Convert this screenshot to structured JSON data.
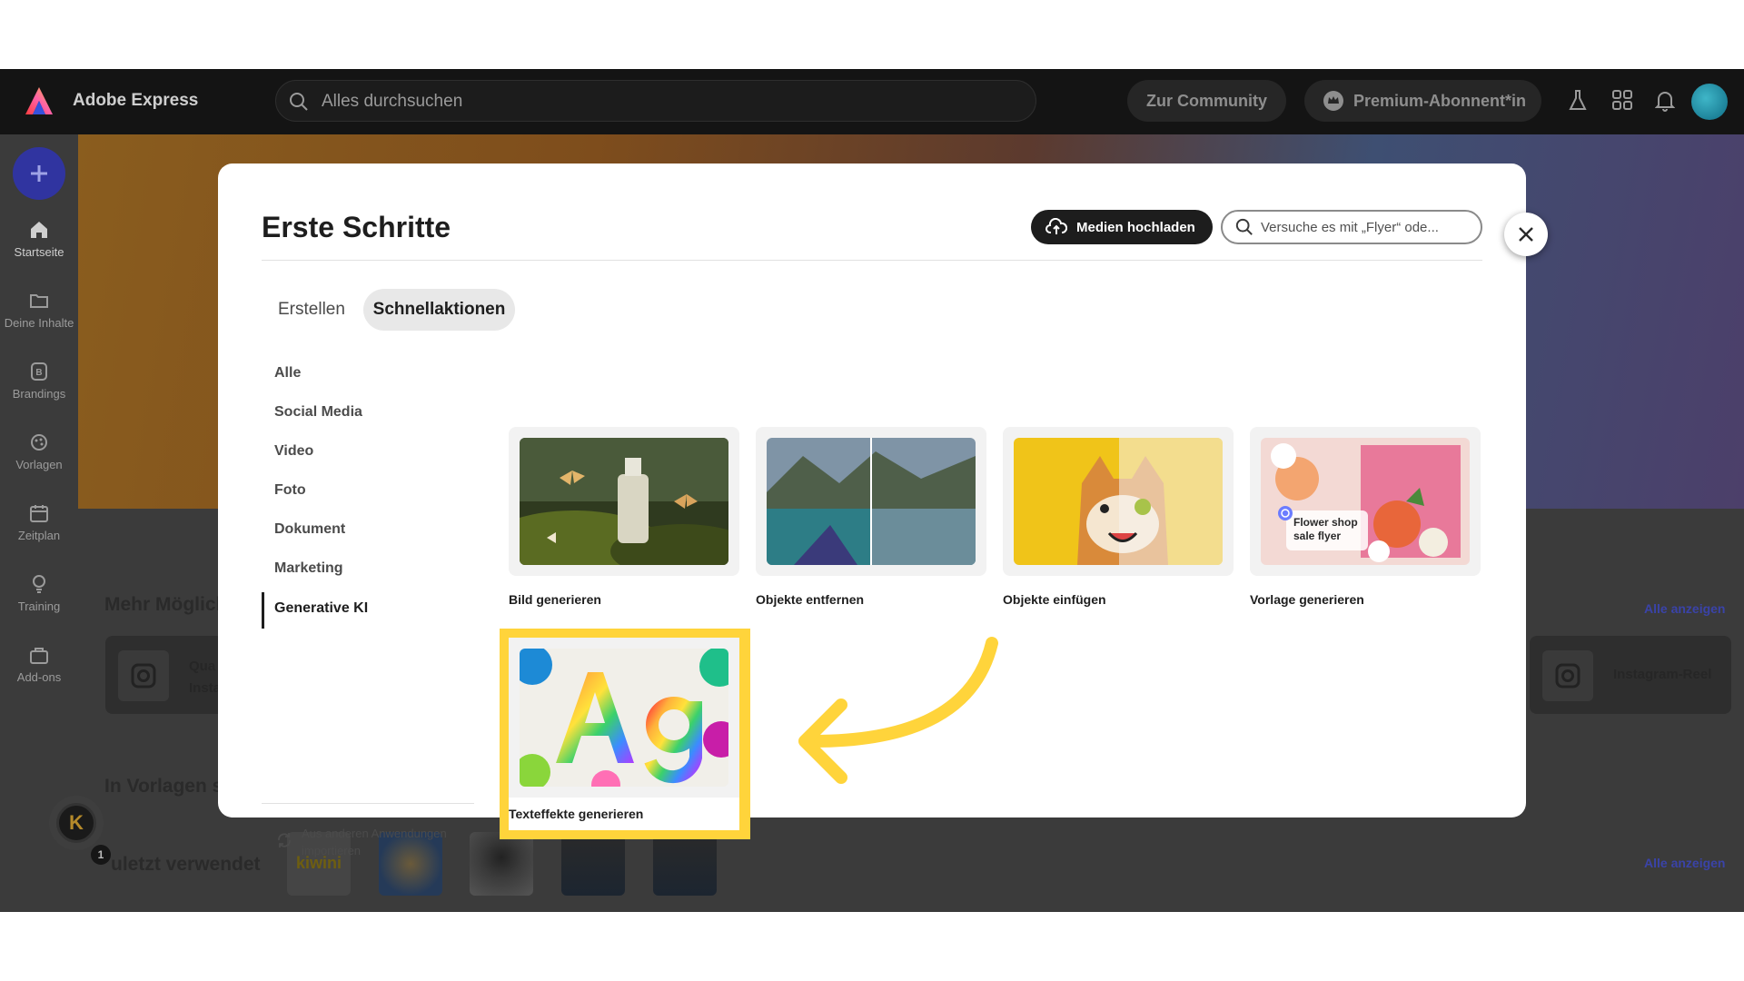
{
  "topbar": {
    "brand": "Adobe Express",
    "search_placeholder": "Alles durchsuchen",
    "community_label": "Zur Community",
    "premium_label": "Premium-Abonnent*in"
  },
  "sidebar": {
    "items": [
      {
        "label": "Startseite",
        "icon": "home-icon"
      },
      {
        "label": "Deine Inhalte",
        "icon": "folder-icon"
      },
      {
        "label": "Brandings",
        "icon": "brand-icon"
      },
      {
        "label": "Vorlagen",
        "icon": "templates-icon"
      },
      {
        "label": "Zeitplan",
        "icon": "calendar-icon"
      },
      {
        "label": "Training",
        "icon": "lightbulb-icon"
      },
      {
        "label": "Add-ons",
        "icon": "addons-icon"
      }
    ]
  },
  "background": {
    "section1_title": "Mehr Möglich",
    "section1_card_line1": "Qua",
    "section1_card_line2": "Insta",
    "instagram_reel": "Instagram-Reel",
    "section2_title": "In Vorlagen su",
    "section3_title": "uletzt verwendet",
    "alle_anzeigen": "Alle anzeigen",
    "kiwini": "kiwini",
    "notification_badge": "1",
    "avatar_letter": "K"
  },
  "modal": {
    "title": "Erste Schritte",
    "upload_label": "Medien hochladen",
    "search_placeholder": "Versuche es mit „Flyer“ ode...",
    "tabs": [
      "Erstellen",
      "Schnellaktionen"
    ],
    "categories": [
      "Alle",
      "Social Media",
      "Video",
      "Foto",
      "Dokument",
      "Marketing",
      "Generative KI"
    ],
    "active_category": "Generative KI",
    "import_label": "Aus anderen Anwendungen importieren",
    "cards": [
      {
        "label": "Bild generieren"
      },
      {
        "label": "Objekte entfernen"
      },
      {
        "label": "Objekte einfügen"
      },
      {
        "label": "Vorlage generieren",
        "overlay": "Flower shop sale flyer"
      }
    ],
    "highlighted_card": {
      "label": "Texteffekte generieren"
    }
  },
  "colors": {
    "highlight": "#ffd43b",
    "accent": "#3034a0"
  }
}
